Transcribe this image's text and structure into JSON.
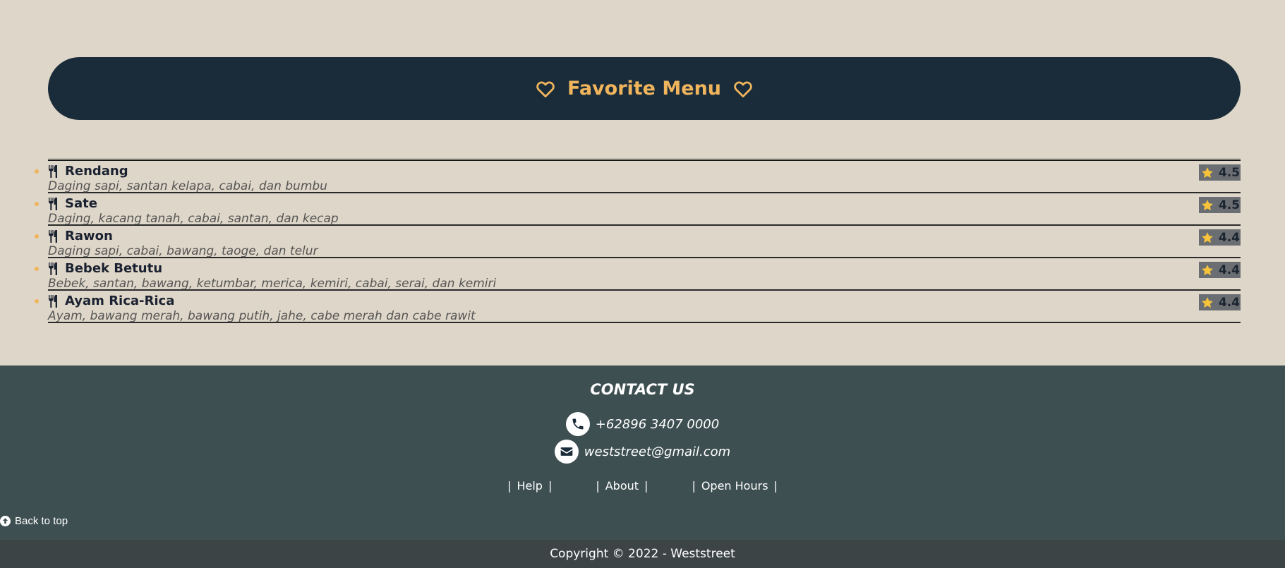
{
  "banner": {
    "title": "Favorite Menu"
  },
  "menu": [
    {
      "name": "Rendang",
      "description": "Daging sapi, santan kelapa, cabai, dan bumbu",
      "rating": "4.5"
    },
    {
      "name": "Sate",
      "description": "Daging, kacang tanah, cabai, santan, dan kecap",
      "rating": "4.5"
    },
    {
      "name": "Rawon",
      "description": "Daging sapi, cabai, bawang, taoge, dan telur",
      "rating": "4.4"
    },
    {
      "name": "Bebek Betutu",
      "description": "Bebek, santan, bawang, ketumbar, merica, kemiri, cabai, serai, dan kemiri",
      "rating": "4.4"
    },
    {
      "name": "Ayam Rica-Rica",
      "description": "Ayam, bawang merah, bawang putih, jahe, cabe merah dan cabe rawit",
      "rating": "4.4"
    }
  ],
  "footer": {
    "contact_title": "CONTACT US",
    "phone": "+62896 3407 0000",
    "email": "weststreet@gmail.com",
    "links": [
      "Help",
      "About",
      "Open Hours"
    ],
    "back_to_top": "Back to top",
    "copyright": "Copyright © 2022 - Weststreet"
  },
  "icons": {
    "heart": "heart-outline-icon",
    "fork_knife": "utensils-icon",
    "star": "star-icon",
    "phone": "phone-icon",
    "email": "envelope-icon",
    "back_to_top": "arrow-up-circle-icon"
  },
  "colors": {
    "banner_bg": "#1a2c3a",
    "accent": "#f0b55c",
    "page_bg": "#ded6c8",
    "footer_bg": "#3e4f51",
    "copyright_bg": "#3c4446",
    "rating_bg": "#6a6e72",
    "star": "#f6c33b"
  }
}
